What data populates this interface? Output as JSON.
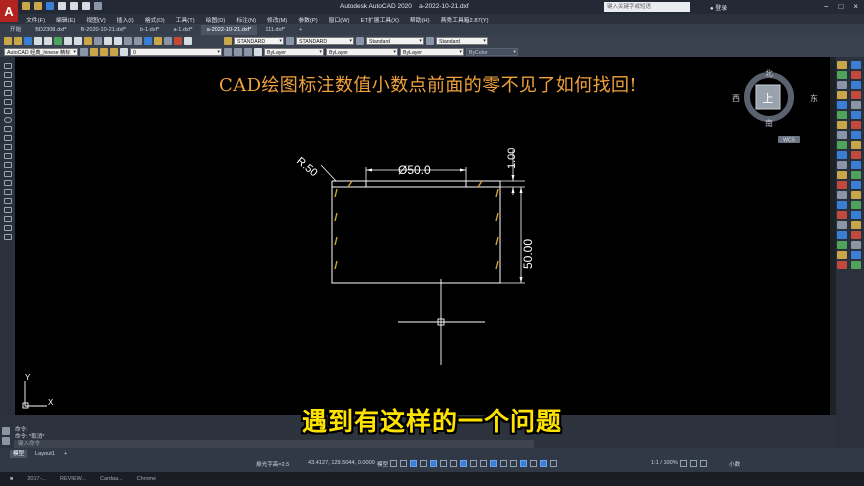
{
  "titlebar": {
    "app_title": "Autodesk AutoCAD 2020",
    "file_name": "a-2022-10-21.dxf",
    "search_placeholder": "键入关键字或短语",
    "login_label": "登录",
    "window_controls": [
      "−",
      "□",
      "×"
    ]
  },
  "menubar": {
    "items": [
      "文件(F)",
      "编辑(E)",
      "视图(V)",
      "插入(I)",
      "格式(O)",
      "工具(T)",
      "绘图(D)",
      "标注(N)",
      "修改(M)",
      "参数(P)",
      "窗口(W)",
      "ET扩展工具(X)",
      "帮助(H)",
      "燕秀工具箱2.87(Y)"
    ]
  },
  "doc_tabs": [
    {
      "label": "开始",
      "active": false
    },
    {
      "label": "BD2308.dxf*",
      "active": false
    },
    {
      "label": "B-2020-10-21.dxf*",
      "active": false
    },
    {
      "label": "b-1.dxf*",
      "active": false
    },
    {
      "label": "a-1.dxf*",
      "active": false
    },
    {
      "label": "a-2022-10-21.dxf*",
      "active": true
    },
    {
      "label": "111.dxf*",
      "active": false
    }
  ],
  "toolbar": {
    "text_style": "STANDARD",
    "dim_style": "STANDARD",
    "table_style": "Standard",
    "multileader_style": "Standard",
    "workspace": "AutoCAD 经典_hinese 精标",
    "layer_value": "0",
    "color": "ByLayer",
    "linetype": "ByLayer",
    "lineweight": "ByLayer",
    "plot_style": "ByColor"
  },
  "canvas": {
    "heading": "CAD绘图标注数值小数点前面的零不见了如何找回!",
    "dim_radius": "R.50",
    "dim_width": "Ø50.0",
    "dim_small": "1.00",
    "dim_height": "50.00",
    "ucs_y": "Y",
    "ucs_x": "X"
  },
  "viewcube": {
    "north": "北",
    "south": "南",
    "east": "东",
    "west": "西",
    "face": "上",
    "wcs": "WCS"
  },
  "subtitle": "遇到有这样的一个问题",
  "command": {
    "line1": "命令:",
    "line2": "命令: *取消*",
    "input_placeholder": "键入命令"
  },
  "status": {
    "tab_model": "模型",
    "tab_layout": "Layout1",
    "tab_add": "+",
    "scale_label": "悬光字高=2.5",
    "coords": "43.4127, 129.5044, 0.0000",
    "model_label": "模型",
    "zoom": "1:1 / 100%",
    "units": "小数"
  },
  "taskbar": {
    "items": [
      "2017-...",
      "REVIEW...",
      "Cardaa...",
      "Chrome"
    ]
  }
}
